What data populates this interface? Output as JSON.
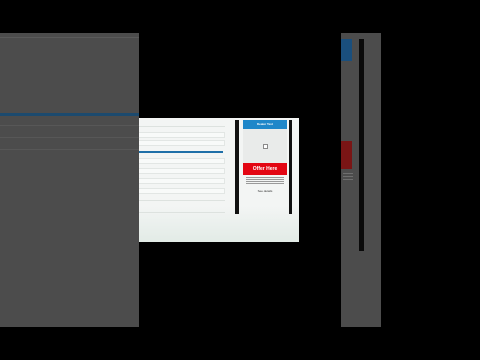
{
  "ad": {
    "header": "Dealer Text",
    "cta_label": "Offer Here",
    "footer": "See details"
  },
  "colors": {
    "background": "#000000",
    "dim_panel": "#4c4c4c",
    "accent_blue": "#1f87c9",
    "cta_red": "#e30613",
    "frame": "#f3f5f4"
  },
  "icons": {
    "ad_image": "broken-image-icon"
  }
}
